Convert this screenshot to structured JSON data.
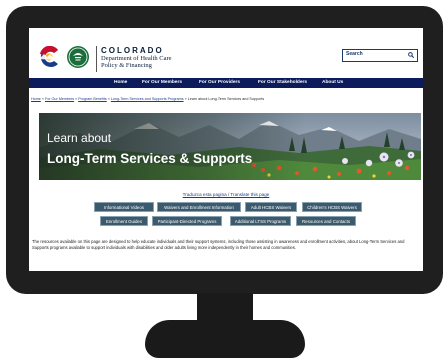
{
  "org": {
    "name": "COLORADO",
    "line1": "Department of Health Care",
    "line2": "Policy & Financing"
  },
  "search": {
    "placeholder": "Search"
  },
  "nav": {
    "items": [
      "Home",
      "For Our Members",
      "For Our Providers",
      "For Our Stakeholders",
      "About Us"
    ]
  },
  "breadcrumb": {
    "home": "Home",
    "members": "For Our Members",
    "benefits": "Program Benefits",
    "ltss": "Long-Term Services and Supports Programs",
    "current": "Learn about Long-Term Services and Supports"
  },
  "hero": {
    "line1": "Learn about",
    "line2": "Long-Term Services & Supports"
  },
  "translate": "Traduzca esta pagina / Translate this page",
  "buttons": {
    "row1": [
      "Informational Videos",
      "Waivers and Enrollment Information",
      "Adult HCBS Waivers",
      "Children's HCBS Waivers"
    ],
    "row2": [
      "Enrollment Guides",
      "Participant-Directed Programs",
      "Additional LTSS Programs",
      "Resources and Contacts"
    ]
  },
  "paragraph": "The resources available on this page are designed to help educate individuals and their support systems, including those assisting in awareness and enrollment activities, about Long-Term Services and Supports programs available to support individuals with disabilities and older adults living more independently in their homes and communities.",
  "colors": {
    "nav_bg": "#0b1b5c",
    "button_bg": "#3b5a6e",
    "link": "#1d3b8a"
  }
}
